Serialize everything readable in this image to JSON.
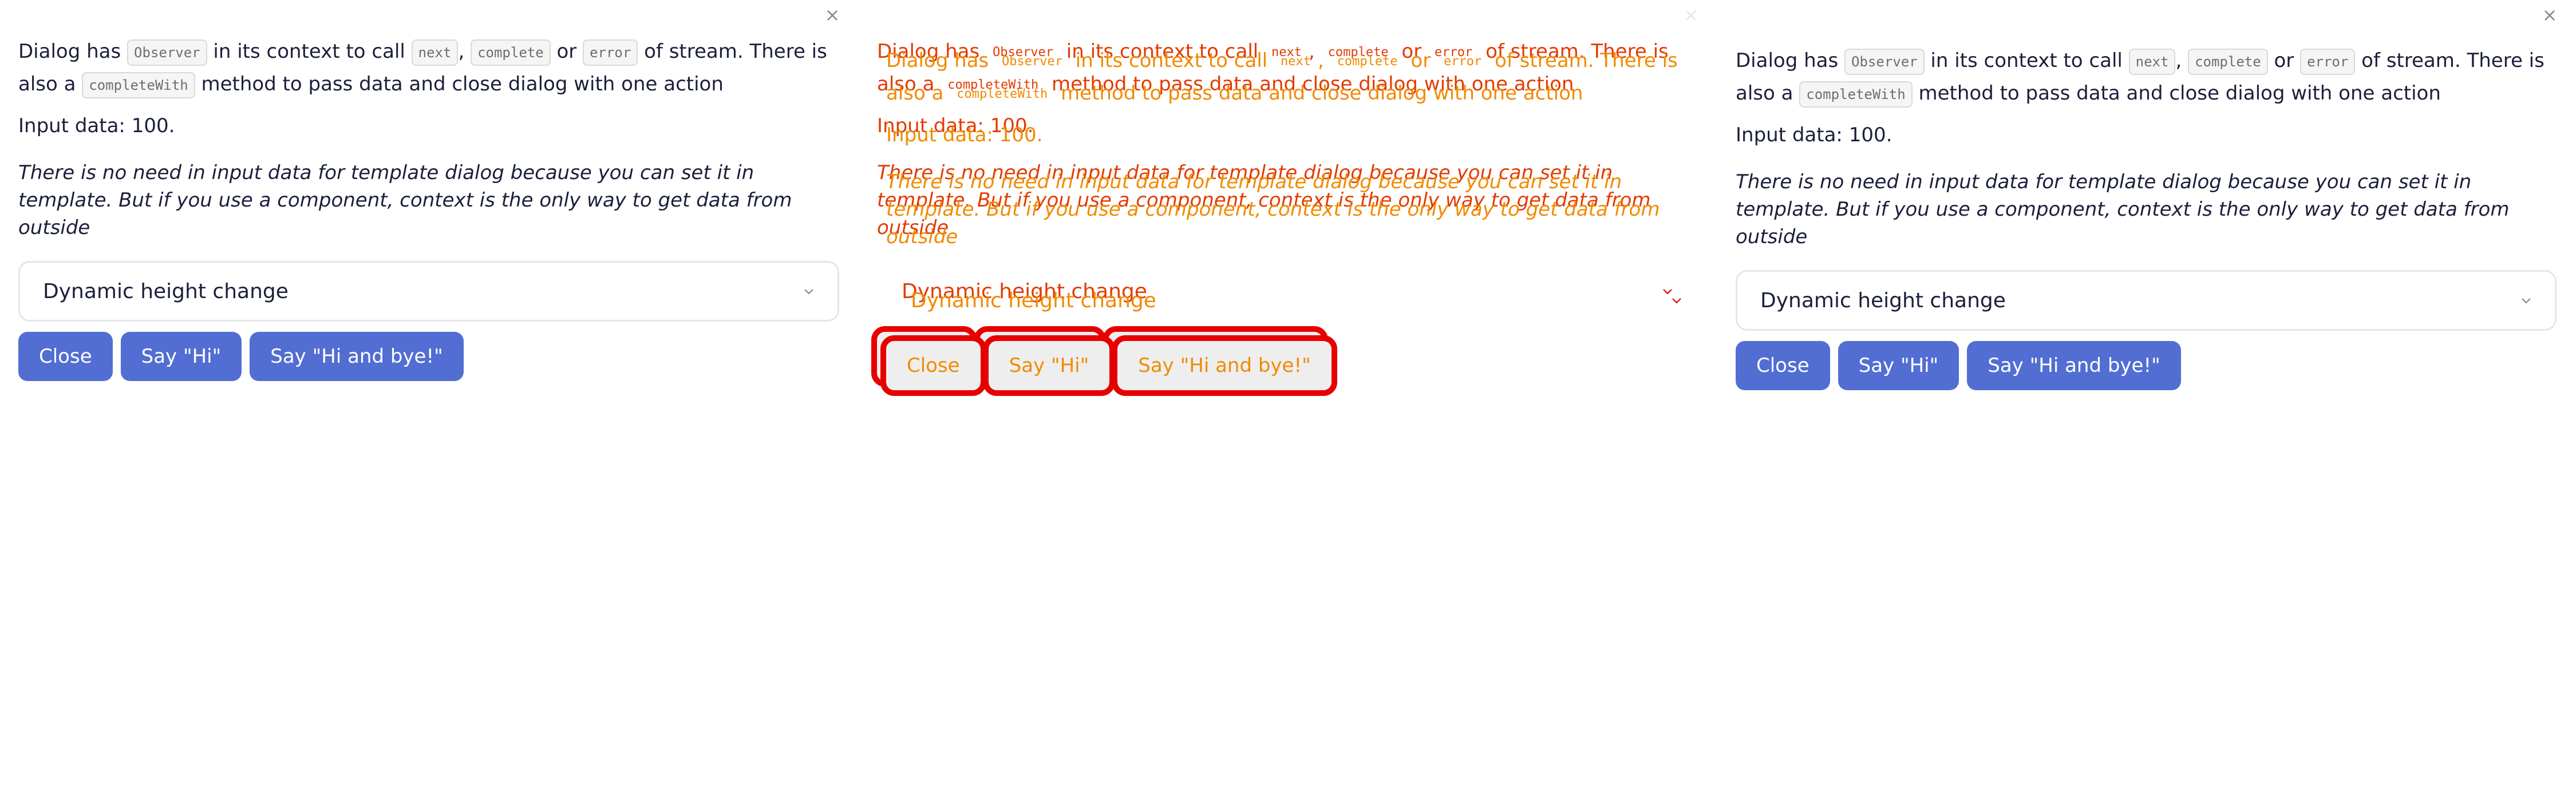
{
  "dialog": {
    "close_symbol": "×",
    "p1_intro": "Dialog has",
    "code_observer": "Observer",
    "p1_mid": "in its context to call",
    "code_next": "next",
    "comma": ",",
    "code_complete": "complete",
    "or_word": "or",
    "code_error": "error",
    "p1_end": "of stream. There is also a",
    "code_complete_with": "completeWith",
    "p1_tail": "method to pass data and close dialog with one action",
    "input_data": "Input data: 100.",
    "note": "There is no need in input data for template dialog because you can set it in template. But if you use a component, context is the only way to get data from outside",
    "select_value": "Dynamic height change",
    "buttons": {
      "close": "Close",
      "say_hi": "Say \"Hi\"",
      "say_hi_bye": "Say \"Hi and bye!\""
    }
  },
  "icons": {
    "close": "close-icon",
    "chevron": "chevron-down-icon"
  },
  "colors": {
    "button_bg": "#526ed3",
    "text": "#1b1f3b",
    "diff_red": "#e60000",
    "diff_orange": "#f08b00"
  }
}
